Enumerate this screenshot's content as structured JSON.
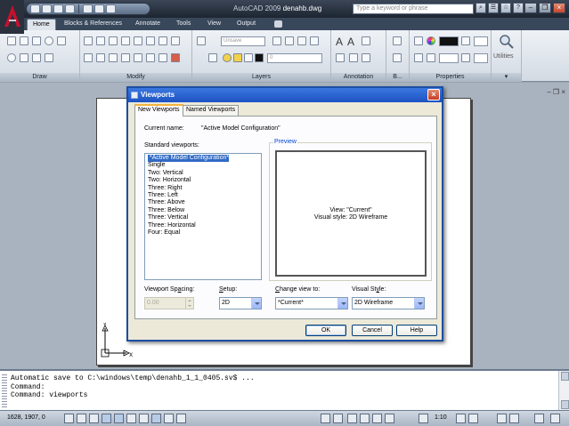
{
  "app": {
    "title_prefix": "AutoCAD 2009",
    "filename": "denahb.dwg",
    "search_placeholder": "Type a keyword or phrase"
  },
  "ribbon": {
    "tabs": [
      "Home",
      "Blocks & References",
      "Annotate",
      "Tools",
      "View",
      "Output"
    ],
    "panels": {
      "draw": "Draw",
      "modify": "Modify",
      "layers": "Layers",
      "annotation": "Annotation",
      "block": "B...",
      "properties": "Properties",
      "utilities": "Utilities"
    },
    "layer_state": "Unsave",
    "layer_current": "0"
  },
  "dialog": {
    "title": "Viewports",
    "tabs": [
      "New Viewports",
      "Named Viewports"
    ],
    "current_name_label": "Current name:",
    "current_name_value": "\"Active Model Configuration\"",
    "standard_label": "Standard viewports:",
    "viewports": [
      "*Active Model Configuration*",
      "Single",
      "Two:  Vertical",
      "Two:  Horizontal",
      "Three: Right",
      "Three: Left",
      "Three: Above",
      "Three: Below",
      "Three: Vertical",
      "Three: Horizontal",
      "Four: Equal"
    ],
    "preview_label": "Preview",
    "preview_line1": "View: \"Current\"",
    "preview_line2": "Visual style: 2D Wireframe",
    "spacing_label_a": "Viewport Sp",
    "spacing_label_u": "a",
    "spacing_label_b": "cing:",
    "spacing_value": "0.00",
    "setup_label_u": "S",
    "setup_label_b": "etup:",
    "setup_value": "2D",
    "change_view_u": "C",
    "change_view_b": "hange view to:",
    "change_view_value": "*Current*",
    "visual_style_a": "Visual St",
    "visual_style_u": "y",
    "visual_style_b": "le:",
    "visual_style_value": "2D Wireframe",
    "ok": "OK",
    "cancel": "Cancel",
    "help": "Help"
  },
  "command_line": [
    "Automatic save to C:\\windows\\temp\\denahb_1_1_0405.sv$ ...",
    "Command:",
    "Command: viewports"
  ],
  "status": {
    "coords": "1628, 1907, 0",
    "zoom": "1:10"
  },
  "colors": {
    "dialog_title": "#1d53c2",
    "selection": "#316ac5",
    "app_logo": "#c8102e"
  }
}
